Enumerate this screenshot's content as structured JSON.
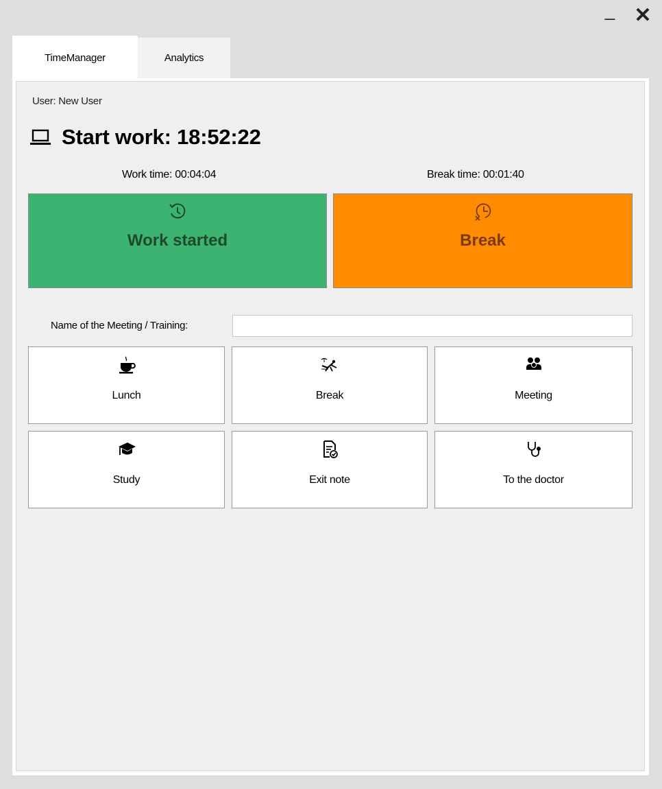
{
  "window": {
    "minimize_glyph": "_",
    "close_glyph": "✕"
  },
  "tabs": [
    {
      "label": "TimeManager",
      "active": true
    },
    {
      "label": "Analytics",
      "active": false
    }
  ],
  "user": {
    "label": "User: New User"
  },
  "start": {
    "title": "Start work: 18:52:22",
    "icon": "laptop-icon"
  },
  "timers": {
    "work": "Work time:  00:04:04",
    "break": "Break time:  00:01:40"
  },
  "status_buttons": {
    "work": {
      "label": "Work started",
      "icon": "restart-clock-icon",
      "color": "#3cb371"
    },
    "break": {
      "label": "Break",
      "icon": "clock-cancel-icon",
      "color": "#ff8c00"
    }
  },
  "meeting": {
    "label": "Name of the Meeting / Training:",
    "value": "",
    "placeholder": ""
  },
  "activities": [
    {
      "label": "Lunch",
      "icon": "coffee-icon"
    },
    {
      "label": "Break",
      "icon": "beach-chair-icon"
    },
    {
      "label": "Meeting",
      "icon": "people-icon"
    },
    {
      "label": "Study",
      "icon": "graduation-cap-icon"
    },
    {
      "label": "Exit note",
      "icon": "document-check-icon"
    },
    {
      "label": "To the doctor",
      "icon": "stethoscope-icon"
    }
  ]
}
